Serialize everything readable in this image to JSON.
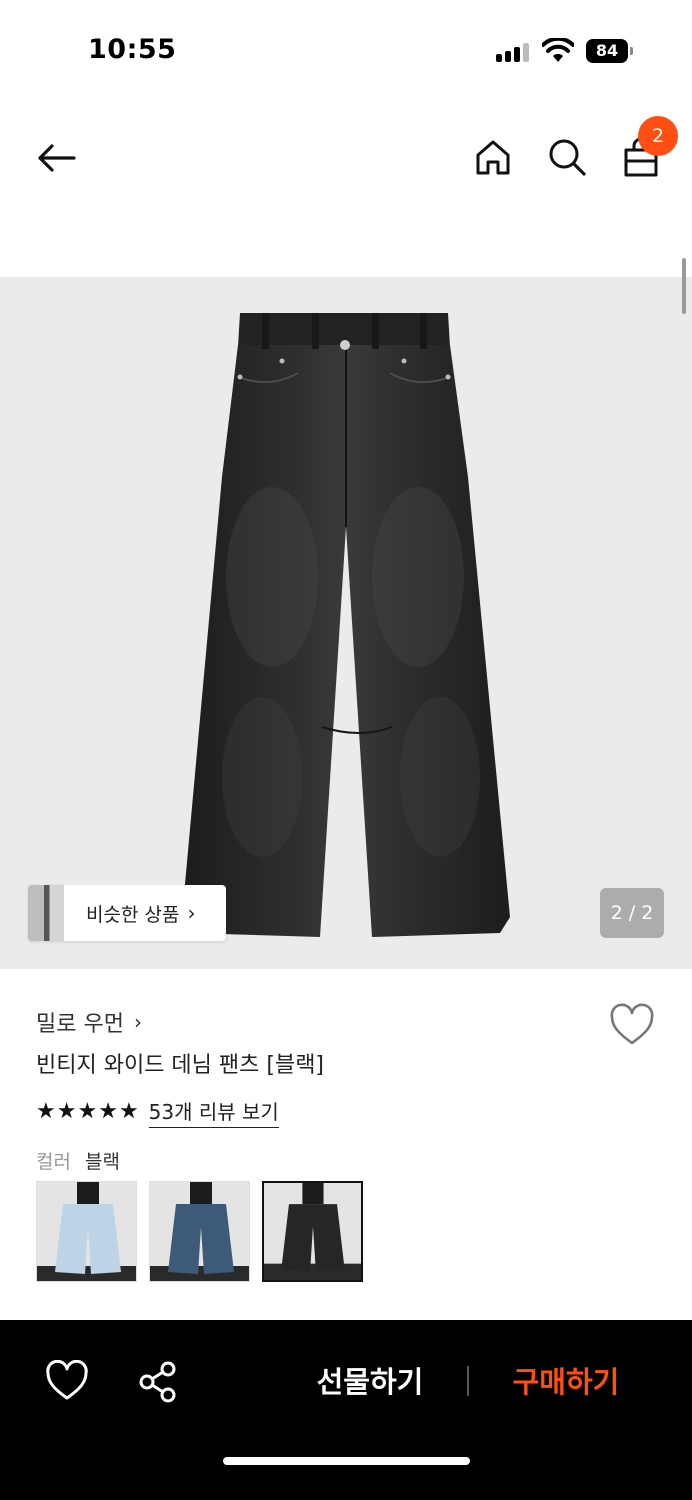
{
  "status_bar": {
    "time": "10:55",
    "battery": "84"
  },
  "header": {
    "cart_count": "2"
  },
  "gallery": {
    "similar_label": "비슷한 상품",
    "page_counter": "2 / 2"
  },
  "product": {
    "brand": "밀로 우먼",
    "title": "빈티지 와이드 데님 팬츠 [블랙]",
    "rating_stars": 5,
    "review_link": "53개 리뷰 보기",
    "color_label": "컬러",
    "color_value": "블랙",
    "swatches": [
      "light-blue",
      "mid-blue",
      "black"
    ]
  },
  "bottom_bar": {
    "gift_label": "선물하기",
    "buy_label": "구매하기"
  },
  "colors": {
    "accent": "#ff4f12",
    "bottom_bar_bg": "#000000",
    "image_bg": "#ebebeb"
  }
}
